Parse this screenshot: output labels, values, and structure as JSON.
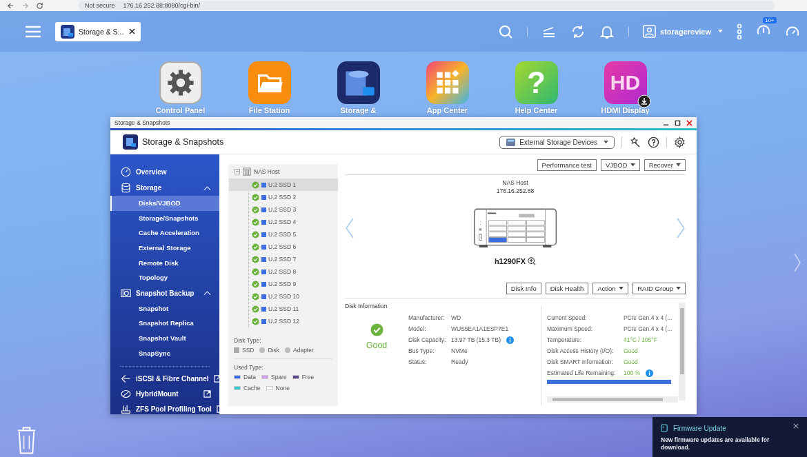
{
  "browser": {
    "security": "Not secure",
    "url": "176.16.252.88:8080/cgi-bin/"
  },
  "topbar": {
    "tab": "Storage & S...",
    "user": "storagereview",
    "badge": "10+"
  },
  "apps": [
    {
      "label": "Control Panel",
      "kind": "gear"
    },
    {
      "label": "File Station",
      "kind": "folder"
    },
    {
      "label": "Storage &",
      "kind": "storage"
    },
    {
      "label": "App Center",
      "kind": "grid"
    },
    {
      "label": "Help Center",
      "kind": "help",
      "glyph": "?"
    },
    {
      "label": "HDMI Display",
      "kind": "hd",
      "glyph": "HD"
    }
  ],
  "window": {
    "title": "Storage & Snapshots",
    "app_title": "Storage & Snapshots",
    "devices_menu": "External Storage Devices"
  },
  "sidebar": [
    {
      "label": "Overview",
      "kind": "page"
    },
    {
      "label": "Storage",
      "kind": "group",
      "expanded": true,
      "children": [
        {
          "label": "Disks/VJBOD",
          "selected": true
        },
        {
          "label": "Storage/Snapshots",
          "selected": false
        },
        {
          "label": "Cache Acceleration",
          "selected": false
        },
        {
          "label": "External Storage",
          "selected": false
        },
        {
          "label": "Remote Disk",
          "selected": false
        },
        {
          "label": "Topology",
          "selected": false
        }
      ]
    },
    {
      "label": "Snapshot Backup",
      "kind": "group",
      "expanded": true,
      "children": [
        {
          "label": "Snapshot",
          "selected": false
        },
        {
          "label": "Snapshot Replica",
          "selected": false
        },
        {
          "label": "Snapshot Vault",
          "selected": false
        },
        {
          "label": "SnapSync",
          "selected": false
        }
      ]
    },
    {
      "label": "iSCSI & Fibre Channel",
      "kind": "external"
    },
    {
      "label": "HybridMount",
      "kind": "external"
    },
    {
      "label": "ZFS Pool Profiling Tool",
      "kind": "external"
    }
  ],
  "tree": {
    "label": "NAS Host",
    "expanded": true,
    "children": [
      {
        "label": "U.2 SSD 1",
        "selected": true
      },
      {
        "label": "U.2 SSD 2",
        "selected": false
      },
      {
        "label": "U.2 SSD 3",
        "selected": false
      },
      {
        "label": "U.2 SSD 4",
        "selected": false
      },
      {
        "label": "U.2 SSD 5",
        "selected": false
      },
      {
        "label": "U.2 SSD 6",
        "selected": false
      },
      {
        "label": "U.2 SSD 7",
        "selected": false
      },
      {
        "label": "U.2 SSD 8",
        "selected": false
      },
      {
        "label": "U.2 SSD 9",
        "selected": false
      },
      {
        "label": "U.2 SSD 10",
        "selected": false
      },
      {
        "label": "U.2 SSD 11",
        "selected": false
      },
      {
        "label": "U.2 SSD 12",
        "selected": false
      }
    ]
  },
  "disk_type": {
    "title": "Disk Type:",
    "items": [
      {
        "label": "SSD",
        "kind": "square"
      },
      {
        "label": "Disk",
        "kind": "dot"
      },
      {
        "label": "Adapter",
        "kind": "dot"
      }
    ]
  },
  "used_type": {
    "title": "Used Type:",
    "items": [
      {
        "label": "Data",
        "color": "#3b6fe0"
      },
      {
        "label": "Spare",
        "color": "#c9a0ec"
      },
      {
        "label": "Free",
        "color": "#5b4a8c"
      },
      {
        "label": "Cache",
        "color": "#3cc6d0"
      },
      {
        "label": "None",
        "color": "#ffffff"
      }
    ]
  },
  "toolbar": [
    {
      "label": "Performance test",
      "dropdown": false
    },
    {
      "label": "VJBOD",
      "dropdown": true
    },
    {
      "label": "Recover",
      "dropdown": true
    }
  ],
  "device": {
    "name": "NAS Host",
    "ip": "176.16.252.88",
    "model": "h1290FX",
    "bays": [
      {
        "selected": false
      },
      {
        "selected": false
      },
      {
        "selected": false
      },
      {
        "selected": false
      },
      {
        "selected": false
      },
      {
        "selected": false
      },
      {
        "selected": false
      },
      {
        "selected": false
      },
      {
        "selected": false
      },
      {
        "selected": true
      },
      {
        "selected": false
      },
      {
        "selected": false
      }
    ]
  },
  "disk_buttons": [
    {
      "label": "Disk Info",
      "dropdown": false
    },
    {
      "label": "Disk Health",
      "dropdown": false
    },
    {
      "label": "Action",
      "dropdown": true
    },
    {
      "label": "RAID Group",
      "dropdown": true
    }
  ],
  "disk_info": {
    "title": "Disk Information",
    "status": "Good",
    "left": [
      {
        "label": "Manufacturer:",
        "value": "WD",
        "info": false
      },
      {
        "label": "Model:",
        "value": "WUS5EA1A1ESP7E1",
        "info": false
      },
      {
        "label": "Disk Capacity:",
        "value": "13.97 TB (15.3 TB)",
        "info": true
      },
      {
        "label": "Bus Type:",
        "value": "NVMe",
        "info": false
      },
      {
        "label": "Status:",
        "value": "Ready",
        "info": false
      }
    ],
    "right": [
      {
        "label": "Current Speed:",
        "value": "PCIe Gen.4 x 4 (...",
        "highlighted": false
      },
      {
        "label": "Maximum Speed:",
        "value": "PCIe Gen.4 x 4 (...",
        "highlighted": false
      },
      {
        "label": "Temperature:",
        "value": "41°C / 105°F",
        "highlighted": true,
        "info": false
      },
      {
        "label": "Disk Access History (I/O):",
        "value": "Good",
        "highlighted": true,
        "info": false
      },
      {
        "label": "Disk SMART Information:",
        "value": "Good",
        "highlighted": true,
        "info": false
      },
      {
        "label": "Estimated Life Remaining:",
        "value": "100 %",
        "highlighted": true,
        "info": true
      }
    ],
    "life": {
      "level": 1
    }
  },
  "notification": {
    "title": "Firmware Update",
    "body": "New firmware updates are available for download."
  }
}
